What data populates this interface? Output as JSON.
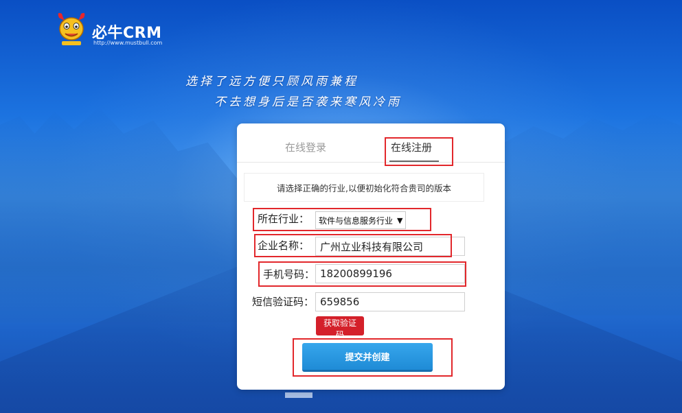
{
  "brand": {
    "name": "必牛CRM",
    "url": "http://www.mustbull.com"
  },
  "slogan": {
    "line1": "选择了远方便只顾风雨兼程",
    "line2": "不去想身后是否袭来寒风冷雨"
  },
  "tabs": {
    "login": "在线登录",
    "register": "在线注册",
    "active": "register"
  },
  "notice": "请选择正确的行业,以便初始化符合贵司的版本",
  "form": {
    "industry_label": "所在行业：",
    "industry_value": "软件与信息服务行业",
    "company_label": "企业名称：",
    "company_value": "广州立业科技有限公司",
    "phone_label": "手机号码：",
    "phone_value": "18200899196",
    "sms_label": "短信验证码：",
    "sms_value": "659856",
    "get_code_button": "获取验证码",
    "submit_button": "提交并创建"
  },
  "colors": {
    "accent_red": "#d4202a",
    "primary_blue": "#2196e0",
    "highlight": "#e2272b"
  }
}
